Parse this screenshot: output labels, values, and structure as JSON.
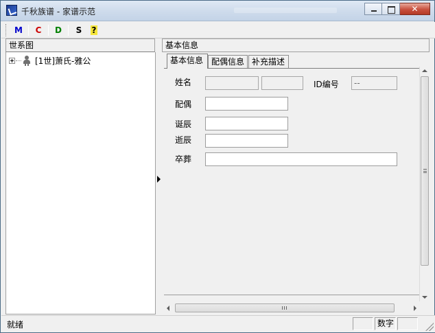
{
  "window": {
    "title": "千秋族谱 - 家谱示范"
  },
  "toolbar": {
    "buttons": [
      {
        "label": "M",
        "color": "#0000cc"
      },
      {
        "label": "C",
        "color": "#cc0000"
      },
      {
        "label": "D",
        "color": "#008000"
      },
      {
        "label": "S",
        "color": "#000000"
      },
      {
        "label": "?",
        "icon": "help-icon",
        "color": "#7a6a00"
      }
    ]
  },
  "left_pane": {
    "header": "世系图",
    "tree": [
      {
        "label": "[1世]萧氏-雅公",
        "icon": "person-icon",
        "expanded": false
      }
    ]
  },
  "right_pane": {
    "header": "基本信息",
    "tabs": [
      {
        "label": "基本信息",
        "active": true
      },
      {
        "label": "配偶信息",
        "active": false
      },
      {
        "label": "补充描述",
        "active": false
      }
    ],
    "form": {
      "name_label": "姓名",
      "surname_value": "",
      "given_name_value": "",
      "id_label": "ID编号",
      "id_value": "--",
      "spouse_label": "配偶",
      "spouse_value": "",
      "birth_label": "诞辰",
      "birth_value": "",
      "death_label": "逝辰",
      "death_value": "",
      "burial_label": "卒葬",
      "burial_value": ""
    }
  },
  "statusbar": {
    "text": "就绪",
    "panels": [
      "",
      "数字",
      ""
    ]
  }
}
